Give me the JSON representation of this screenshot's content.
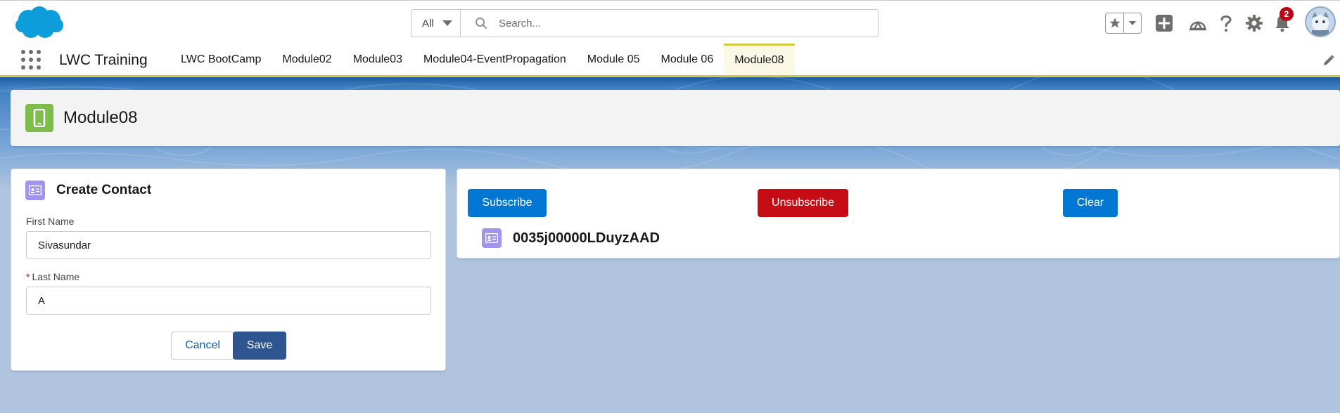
{
  "header": {
    "search_scope": "All",
    "search_placeholder": "Search...",
    "notification_count": "2"
  },
  "nav": {
    "app_name": "LWC Training",
    "tabs": [
      {
        "label": "LWC BootCamp",
        "active": false
      },
      {
        "label": "Module02",
        "active": false
      },
      {
        "label": "Module03",
        "active": false
      },
      {
        "label": "Module04-EventPropagation",
        "active": false
      },
      {
        "label": "Module 05",
        "active": false
      },
      {
        "label": "Module 06",
        "active": false
      },
      {
        "label": "Module08",
        "active": true
      }
    ]
  },
  "page": {
    "title": "Module08"
  },
  "create_contact": {
    "title": "Create Contact",
    "first_name_label": "First Name",
    "first_name_value": "Sivasundar",
    "last_name_required": "*",
    "last_name_label": "Last Name",
    "last_name_value": "A",
    "cancel_label": "Cancel",
    "save_label": "Save"
  },
  "subscriber": {
    "subscribe_label": "Subscribe",
    "unsubscribe_label": "Unsubscribe",
    "clear_label": "Clear",
    "record_id": "0035j00000LDuyzAAD"
  },
  "colors": {
    "brand_blue": "#0176d3",
    "save_blue": "#2e5590",
    "unsubscribe_red": "#c50b14",
    "page_icon_green": "#7ebd4c",
    "contact_icon_purple": "#a094ed",
    "active_tab_accent": "#d4c93a"
  },
  "icons": [
    "salesforce-cloud-logo",
    "search-icon",
    "star-icon",
    "chevron-down-icon",
    "add-icon",
    "trailhead-icon",
    "help-icon",
    "gear-icon",
    "bell-icon",
    "avatar",
    "app-launcher-icon",
    "pencil-icon",
    "mobile-icon",
    "contact-card-icon"
  ]
}
